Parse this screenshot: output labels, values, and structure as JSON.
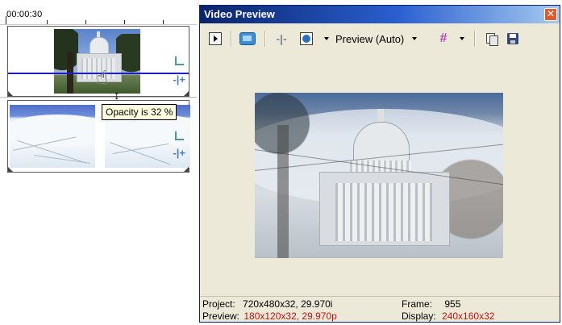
{
  "timeline": {
    "ruler_time": "00:00:30",
    "opacity_tooltip": "Opacity is 32 %"
  },
  "preview_window": {
    "title": "Video Preview",
    "close_glyph": "✕",
    "toolbar": {
      "preview_quality": "Preview (Auto)",
      "icons": [
        "select-icon",
        "monitor-icon",
        "split-screen-icon",
        "overlay-icon",
        "grid-icon",
        "copy-snapshot-icon",
        "save-snapshot-icon"
      ]
    },
    "status": {
      "project_label": "Project:",
      "project_value": "720x480x32, 29.970i",
      "preview_label": "Preview:",
      "preview_value": "180x120x32, 29.970p",
      "frame_label": "Frame:",
      "frame_value": "955",
      "display_label": "Display:",
      "display_value": "240x160x32"
    }
  },
  "colors": {
    "title_bar": "#0a246a",
    "window_bg": "#ece9d8",
    "track_line": "#1c1cc8",
    "status_red": "#b81414",
    "tooltip_bg": "#ffffe1"
  }
}
